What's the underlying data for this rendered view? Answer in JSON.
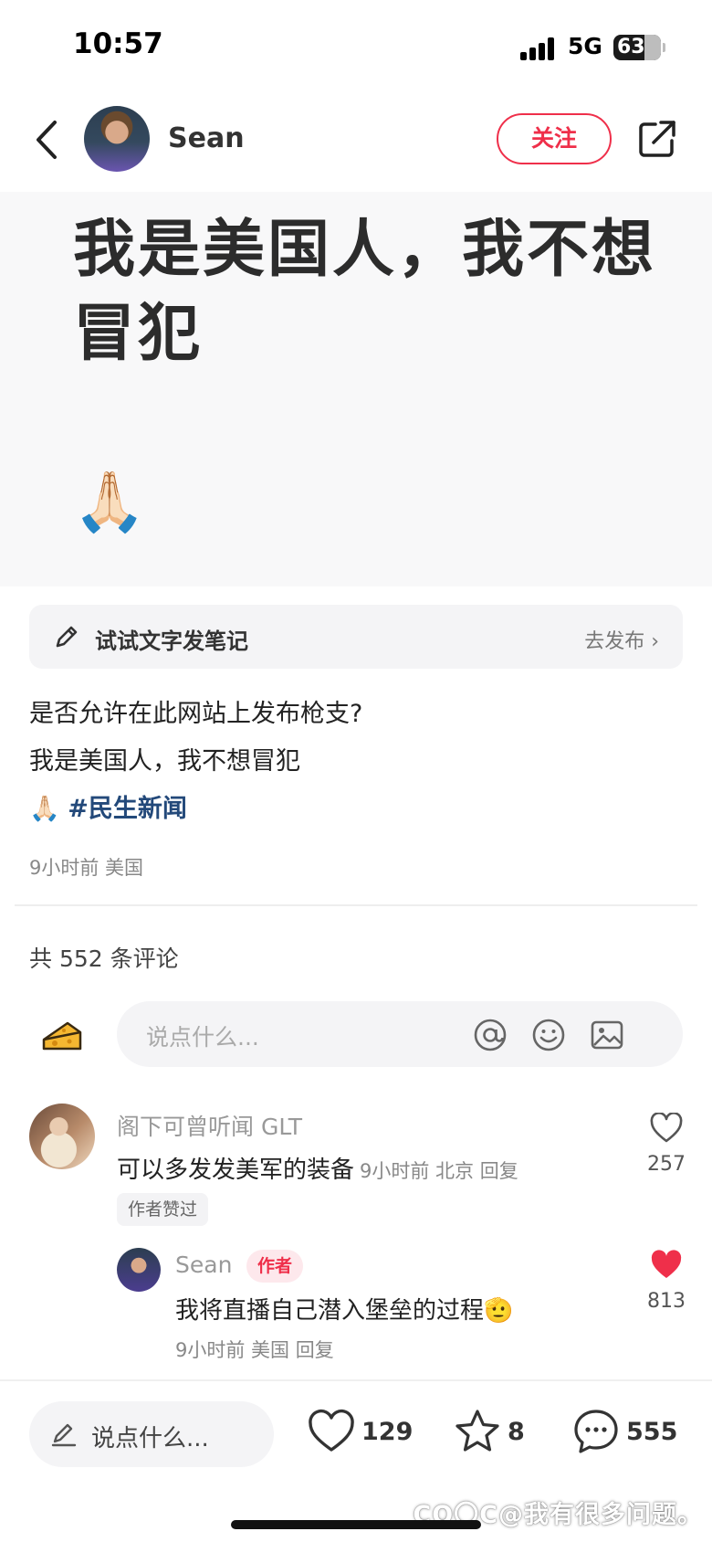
{
  "status_bar": {
    "time": "10:57",
    "network": "5G",
    "battery": "63"
  },
  "header": {
    "author_name": "Sean",
    "follow_label": "关注"
  },
  "hero": {
    "text": "我是美国人，我不想冒犯",
    "emoji": "🙏🏻"
  },
  "try_note": {
    "label": "试试文字发笔记",
    "publish_label": "去发布 ›"
  },
  "post": {
    "line1": "是否允许在此网站上发布枪支?",
    "line2": "我是美国人，我不想冒犯",
    "emoji": "🙏🏻",
    "hashtag": "#民生新闻",
    "meta": "9小时前 美国"
  },
  "comments_header": "共 552 条评论",
  "comment_input": {
    "placeholder": "说点什么..."
  },
  "comments": [
    {
      "user": "阁下可曾听闻 GLT",
      "text": "可以多发发美军的装备",
      "meta": "9小时前 北京 回复",
      "likes": "257",
      "badge": "作者赞过"
    },
    {
      "user": "Sean",
      "tag": "作者",
      "text": "我将直播自己潜入堡垒的过程🫡",
      "meta": "9小时前 美国 回复",
      "likes": "813"
    }
  ],
  "bottom_bar": {
    "input_label": "说点什么...",
    "likes": "129",
    "stars": "8",
    "comments": "555",
    "watermark": "CO〇C@我有很多问题。"
  },
  "colors": {
    "accent": "#ef2f4a",
    "hashtag": "#23497a"
  },
  "icons": [
    "back-icon",
    "share-icon",
    "pencil-icon",
    "cheese-icon",
    "at-icon",
    "emoji-icon",
    "image-icon",
    "heart-icon",
    "heart-filled-icon",
    "star-icon",
    "chat-icon"
  ]
}
